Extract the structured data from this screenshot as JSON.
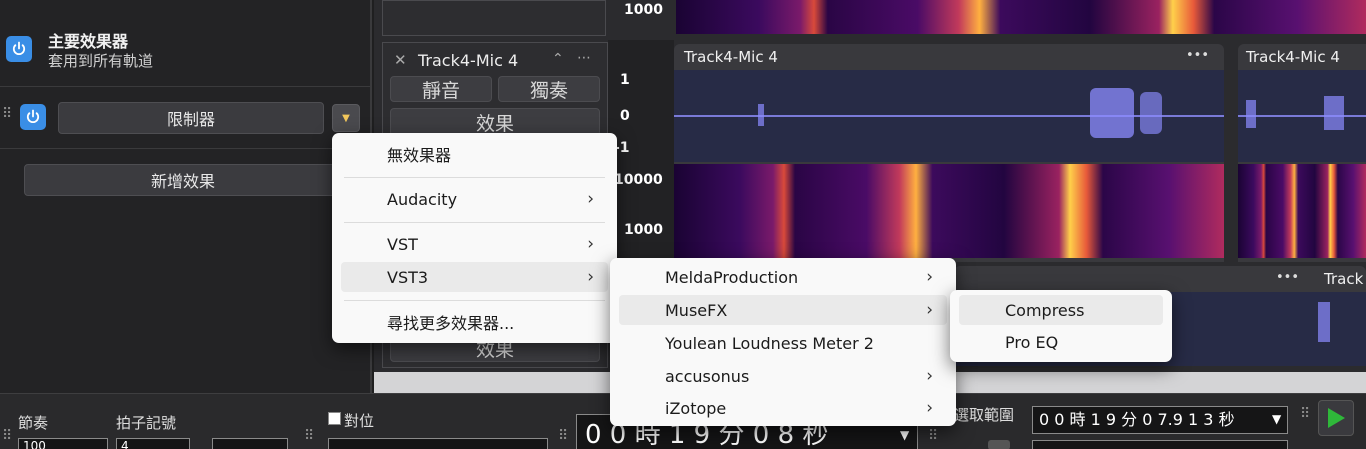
{
  "master_effects": {
    "title": "主要效果器",
    "subtitle": "套用到所有軌道",
    "effect_name": "限制器",
    "add_effect": "新增效果"
  },
  "tracks": {
    "track4_header": "Track4-Mic 4",
    "mute": "靜音",
    "solo": "獨奏",
    "effects": "效果",
    "effects_lower": "效果",
    "clip1_title": "Track4-Mic 4",
    "clip2_title": "Track4-Mic 4",
    "clip3_title": "Track",
    "scale_top": "1000",
    "scale_1": "1",
    "scale_0": "0",
    "scale_m1": "-1",
    "scale_10000": "10000",
    "scale_1000b": "1000",
    "more": "•••"
  },
  "effect_menu": {
    "items": [
      {
        "label": "無效果器"
      },
      {
        "label": "Audacity",
        "arrow": "›"
      },
      {
        "label": "VST",
        "arrow": "›"
      },
      {
        "label": "VST3",
        "arrow": "›"
      },
      {
        "label": "尋找更多效果器..."
      }
    ]
  },
  "vst3_menu": {
    "items": [
      {
        "label": "MeldaProduction",
        "arrow": "›"
      },
      {
        "label": "MuseFX",
        "arrow": "›"
      },
      {
        "label": "Youlean Loudness Meter 2"
      },
      {
        "label": "accusonus",
        "arrow": "›"
      },
      {
        "label": "iZotope",
        "arrow": "›"
      }
    ]
  },
  "musefx_menu": {
    "items": [
      {
        "label": "Compress"
      },
      {
        "label": "Pro EQ"
      }
    ]
  },
  "toolbar": {
    "tempo_label": "節奏",
    "time_sig_label": "拍子記號",
    "snap_label": "對位",
    "time_display": "0 0 時 1 9 分 0 8 秒",
    "selection_label": "選取範圍",
    "selection_start": "0 0 時 1 9 分 0 7.9 1 3 秒",
    "tempo_value": "100",
    "time_sig_value": "4"
  },
  "colors": {
    "accent": "#3a8ee6",
    "play": "#2fb83a",
    "waveform": "#8c8cff"
  }
}
